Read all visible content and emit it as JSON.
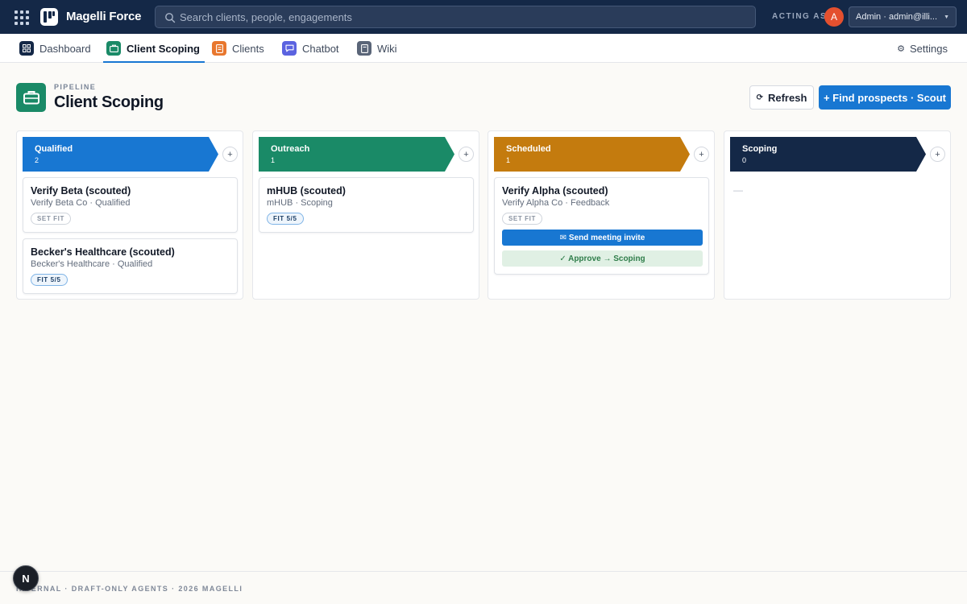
{
  "topbar": {
    "brand": "Magelli Force",
    "search_placeholder": "Search clients, people, engagements",
    "acting_as_label": "ACTING AS",
    "avatar_initial": "A",
    "user_selected": "Admin · admin@illi..."
  },
  "nav": {
    "tabs": [
      {
        "label": "Dashboard",
        "icon": "grid-icon",
        "color": "#142847"
      },
      {
        "label": "Client Scoping",
        "icon": "briefcase-icon",
        "color": "#1a8a67",
        "active": true
      },
      {
        "label": "Clients",
        "icon": "document-icon",
        "color": "#e8772e"
      },
      {
        "label": "Chatbot",
        "icon": "chat-icon",
        "color": "#5b63e0"
      },
      {
        "label": "Wiki",
        "icon": "page-icon",
        "color": "#5a6578"
      }
    ],
    "settings_label": "Settings"
  },
  "header": {
    "eyebrow": "PIPELINE",
    "title": "Client Scoping",
    "refresh_label": "Refresh",
    "find_label": "+ Find prospects · Scout"
  },
  "columns": [
    {
      "name": "Qualified",
      "count": "2",
      "color": "#1877d2",
      "cards": [
        {
          "title": "Verify Beta (scouted)",
          "subtitle": "Verify Beta Co · Qualified",
          "chip": "SET FIT"
        },
        {
          "title": "Becker's Healthcare (scouted)",
          "subtitle": "Becker's Healthcare · Qualified",
          "chip": "FIT 5/5"
        }
      ]
    },
    {
      "name": "Outreach",
      "count": "1",
      "color": "#1a8a67",
      "cards": [
        {
          "title": "mHUB (scouted)",
          "subtitle": "mHUB · Scoping",
          "chip": "FIT 5/5"
        }
      ]
    },
    {
      "name": "Scheduled",
      "count": "1",
      "color": "#c47b0e",
      "cards": [
        {
          "title": "Verify Alpha (scouted)",
          "subtitle": "Verify Alpha Co · Feedback",
          "chip": "SET FIT",
          "action_primary": "✉ Send meeting invite",
          "action_approve": "✓ Approve → Scoping"
        }
      ]
    },
    {
      "name": "Scoping",
      "count": "0",
      "color": "#142847",
      "empty": "—"
    }
  ],
  "footer": {
    "text": "INTERNAL · DRAFT-ONLY AGENTS · 2026 MAGELLI",
    "badge": "N"
  }
}
